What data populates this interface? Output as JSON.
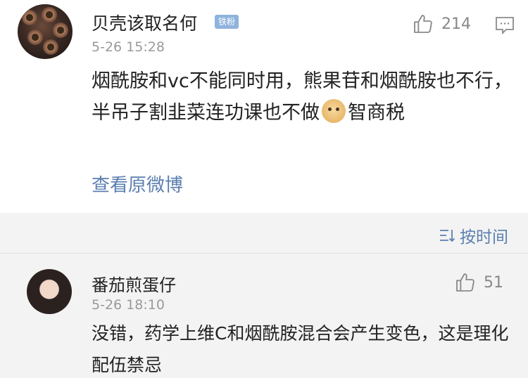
{
  "comment1": {
    "username": "贝壳该取名何",
    "badge": "铁粉",
    "timestamp": "5-26 15:28",
    "likes": "214",
    "text_part1": "烟酰胺和vc不能同时用，熊果苷和烟酰胺也不行，半吊子割韭菜连功课也不做",
    "text_part2": "智商税",
    "view_original": "查看原微博"
  },
  "sort": {
    "label": "按时间"
  },
  "comment2": {
    "username": "番茄煎蛋仔",
    "timestamp": "5-26 18:10",
    "likes": "51",
    "text": "没错，药学上维C和烟酰胺混合会产生变色，这是理化配伍禁忌"
  },
  "colors": {
    "link": "#5b7fb0",
    "badge": "#8fb3de",
    "meta": "#9a9a9a"
  },
  "icons": [
    "thumbs-up-icon",
    "comment-icon",
    "sort-icon",
    "doge-emoji-icon"
  ]
}
